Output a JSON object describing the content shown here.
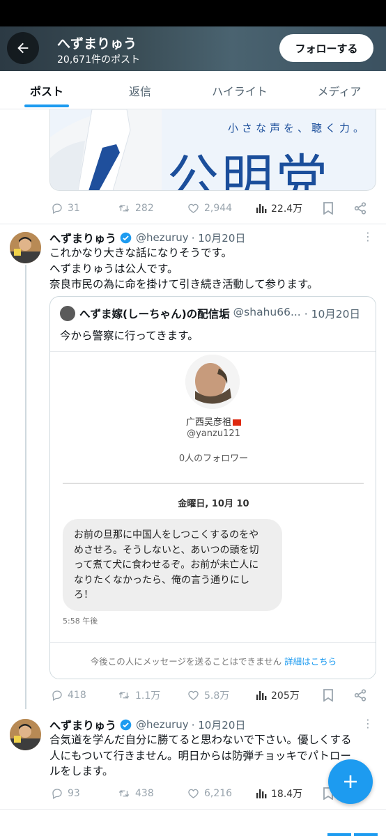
{
  "header": {
    "title": "へずまりゅう",
    "post_count": "20,671件のポスト",
    "follow_label": "フォローする"
  },
  "tabs": [
    {
      "label": "ポスト",
      "active": true
    },
    {
      "label": "返信"
    },
    {
      "label": "ハイライト"
    },
    {
      "label": "メディア"
    }
  ],
  "tweet0": {
    "image_catch": "小さな声を、聴く力。",
    "image_logo": "公明党",
    "replies": "31",
    "reposts": "282",
    "likes": "2,944",
    "views": "22.4万"
  },
  "tweet1": {
    "name": "へずまりゅう",
    "handle": "@hezuruy",
    "date": "· 10月20日",
    "lines": [
      "これかなり大きな話になりそうです。",
      "へずまりゅうは公人です。",
      "奈良市民の為に命を掛けて引き続き活動して参ります。"
    ],
    "quote": {
      "name": "へずま嫁(しーちゃん)の配信垢",
      "handle": "@shahu66...",
      "date": "· 10月20日",
      "text": "今から警察に行ってきます。",
      "screenshot": {
        "name": "广西吴彦祖",
        "handle": "@yanzu121",
        "followers": "0人のフォロワー",
        "date": "金曜日, 10月 10",
        "message_lines": [
          "お前の旦那に中国人をしつこくするのをや",
          "めさせろ。そうしないと、あいつの頭を切",
          "って煮て犬に食わせるぞ。お前が未亡人に",
          "なりたくなかったら、俺の言う通りにし",
          "ろ！"
        ],
        "time": "5:58 午後",
        "footer": "今後この人にメッセージを送ることはできません",
        "footer_link": "詳細はこちら"
      }
    },
    "replies": "418",
    "reposts": "1.1万",
    "likes": "5.8万",
    "views": "205万"
  },
  "tweet2": {
    "name": "へずまりゅう",
    "handle": "@hezuruy",
    "date": "· 10月20日",
    "lines": [
      "合気道を学んだ自分に勝てると思わないで下さい。優しくする",
      "人にもついて行きません。明日からは防弾チョッキでパトロー",
      "ルをします。"
    ],
    "replies": "93",
    "reposts": "438",
    "likes": "6,216",
    "views": "18.4万"
  },
  "more_glyph": "⋮",
  "colors": {
    "accent": "#1d9bf0",
    "text": "#0f1419",
    "muted": "#536471"
  },
  "icons": [
    "back-arrow-icon",
    "reply-icon",
    "repost-icon",
    "like-icon",
    "views-icon",
    "bookmark-icon",
    "share-icon",
    "verified-icon",
    "plus-icon"
  ]
}
